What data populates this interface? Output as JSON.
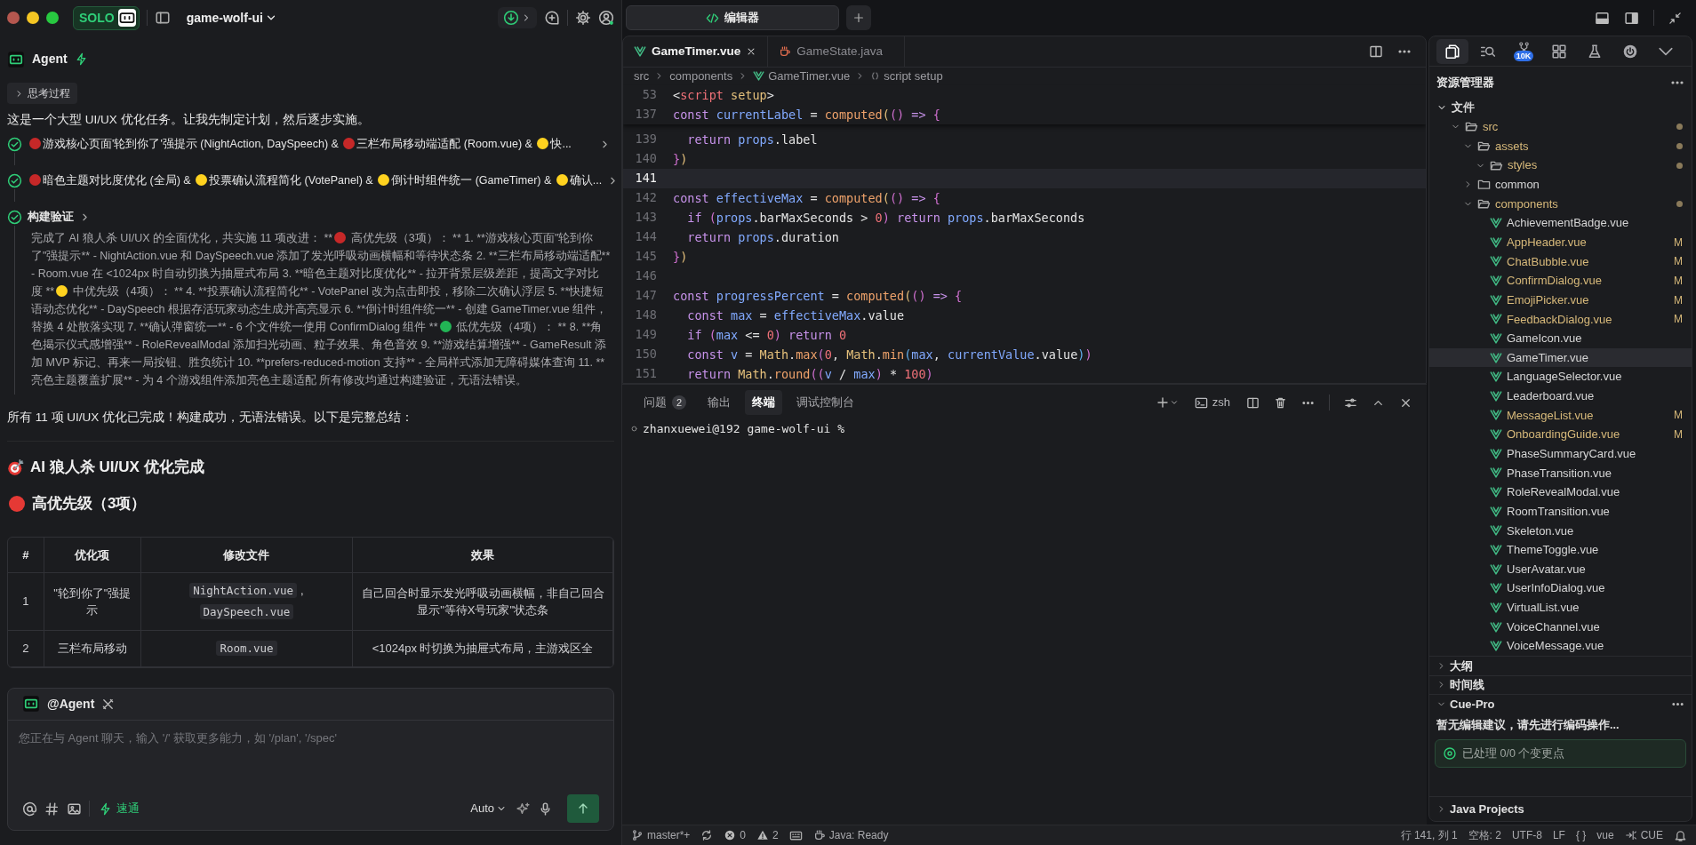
{
  "topbar": {
    "brand": "SOLO",
    "project": "game-wolf-ui"
  },
  "agent": {
    "name": "Agent"
  },
  "thinking": {
    "label": "思考过程",
    "expanded": false
  },
  "intro": "这是一个大型 UI/UX 优化任务。让我先制定计划，然后逐步实施。",
  "steps": [
    {
      "done": true,
      "expanded": false,
      "segments": [
        {
          "kind": "dot",
          "color": "#c62828"
        },
        {
          "kind": "text",
          "text": "游戏核心页面'轮到你了'强提示 (NightAction, DaySpeech) & "
        },
        {
          "kind": "dot",
          "color": "#c62828"
        },
        {
          "kind": "text",
          "text": "三栏布局移动端适配 (Room.vue) & "
        },
        {
          "kind": "dot",
          "color": "#ffd21f"
        },
        {
          "kind": "text",
          "text": "快..."
        }
      ]
    },
    {
      "done": true,
      "expanded": false,
      "segments": [
        {
          "kind": "dot",
          "color": "#c62828"
        },
        {
          "kind": "text",
          "text": "暗色主题对比度优化 (全局) & "
        },
        {
          "kind": "dot",
          "color": "#ffd21f"
        },
        {
          "kind": "text",
          "text": "投票确认流程简化 (VotePanel) & "
        },
        {
          "kind": "dot",
          "color": "#ffd21f"
        },
        {
          "kind": "text",
          "text": "倒计时组件统一 (GameTimer) & "
        },
        {
          "kind": "dot",
          "color": "#ffd21f"
        },
        {
          "kind": "text",
          "text": "确认..."
        }
      ]
    },
    {
      "done": true,
      "expanded": true,
      "segments": [
        {
          "kind": "text",
          "text": "构建验证"
        }
      ],
      "detail": [
        {
          "kind": "text",
          "text": "完成了 AI 狼人杀 UI/UX 的全面优化，共实施 11 项改进： **"
        },
        {
          "kind": "dot",
          "color": "#c62828"
        },
        {
          "kind": "text",
          "text": " 高优先级（3项）： ** 1. **游戏核心页面\"轮到你了\"强提示** - NightAction.vue 和 DaySpeech.vue 添加了发光呼吸动画横幅和等待状态条 2. **三栏布局移动端适配** - Room.vue 在 <1024px 时自动切换为抽屉式布局 3. **暗色主题对比度优化** - 拉开背景层级差距，提高文字对比度 **"
        },
        {
          "kind": "dot",
          "color": "#ffd21f"
        },
        {
          "kind": "text",
          "text": " 中优先级（4项）： ** 4. **投票确认流程简化** - VotePanel 改为点击即投，移除二次确认浮层 5. **快捷短语动态优化** - DaySpeech 根据存活玩家动态生成并高亮显示 6. **倒计时组件统一** - 创建 GameTimer.vue 组件，替换 4 处散落实现 7. **确认弹窗统一** - 6 个文件统一使用 ConfirmDialog 组件 **"
        },
        {
          "kind": "dot",
          "color": "#22b455"
        },
        {
          "kind": "text",
          "text": " 低优先级（4项）： ** 8. **角色揭示仪式感增强** - RoleRevealModal 添加扫光动画、粒子效果、角色音效 9. **游戏结算增强** - GameResult 添加 MVP 标记、再来一局按钮、胜负统计 10. **prefers-reduced-motion 支持** - 全局样式添加无障碍媒体查询 11. **亮色主题覆盖扩展** - 为 4 个游戏组件添加亮色主题适配 所有修改均通过构建验证，无语法错误。"
        }
      ]
    }
  ],
  "conclusion": "所有 11 项 UI/UX 优化已完成！构建成功，无语法错误。以下是完整总结：",
  "headings": [
    {
      "kind": "target",
      "text": "AI 狼人杀 UI/UX 优化完成"
    },
    {
      "kind": "dot",
      "color": "#e53935",
      "text": "高优先级（3项）"
    }
  ],
  "table": {
    "columns": [
      "#",
      "优化项",
      "修改文件",
      "效果"
    ],
    "rows": [
      {
        "cells": [
          {
            "kind": "text",
            "text": "1"
          },
          {
            "kind": "text",
            "text": "\"轮到你了\"强提示"
          },
          {
            "kind": "files",
            "files": [
              {
                "text": "NightAction.vue",
                "after": ","
              },
              {
                "text": "DaySpeech.vue"
              }
            ]
          },
          {
            "kind": "text",
            "text": "自己回合时显示发光呼吸动画横幅，非自己回合显示\"等待X号玩家\"状态条"
          }
        ]
      },
      {
        "cells": [
          {
            "kind": "text",
            "text": "2"
          },
          {
            "kind": "text",
            "text": "三栏布局移动"
          },
          {
            "kind": "files",
            "files": [
              {
                "text": "Room.vue"
              }
            ]
          },
          {
            "kind": "text",
            "text": "<1024px 时切换为抽屉式布局，主游戏区全"
          }
        ]
      }
    ]
  },
  "composer": {
    "mention": "@Agent",
    "placeholder": "您正在与 Agent 聊天，输入 '/' 获取更多能力，如 '/plan', '/spec'",
    "mode": "速通",
    "model": "Auto"
  },
  "editor": {
    "tab": "编辑器",
    "files": [
      {
        "name": "GameTimer.vue",
        "kind": "vue",
        "selected": true
      },
      {
        "name": "GameState.java",
        "kind": "java",
        "selected": false
      }
    ],
    "breadcrumb": [
      {
        "kind": "folder",
        "text": "src"
      },
      {
        "kind": "folder",
        "text": "components"
      },
      {
        "kind": "vue",
        "text": "GameTimer.vue"
      },
      {
        "kind": "symbol",
        "text": "script setup"
      }
    ],
    "sticky_lines": [
      {
        "number": "53",
        "tokens": [
          {
            "kind": "p",
            "text": "<"
          },
          {
            "kind": "t",
            "text": "script"
          },
          {
            "kind": "y",
            "text": " setup"
          },
          {
            "kind": "p",
            "text": ">"
          }
        ]
      },
      {
        "number": "137",
        "tokens": [
          {
            "kind": "k",
            "text": "const "
          },
          {
            "kind": "v",
            "text": "currentLabel"
          },
          {
            "kind": "p",
            "text": " = "
          },
          {
            "kind": "f",
            "text": "computed"
          },
          {
            "kind": "y",
            "text": "("
          },
          {
            "kind": "m",
            "text": "()"
          },
          {
            "kind": "k",
            "text": " => "
          },
          {
            "kind": "m",
            "text": "{"
          }
        ]
      }
    ],
    "lines": [
      {
        "number": "139",
        "current": false,
        "tokens": [
          {
            "kind": "k",
            "text": "  return "
          },
          {
            "kind": "v",
            "text": "props"
          },
          {
            "kind": "p",
            "text": ".label"
          }
        ]
      },
      {
        "number": "140",
        "current": false,
        "tokens": [
          {
            "kind": "m",
            "text": "}"
          },
          {
            "kind": "y",
            "text": ")"
          }
        ]
      },
      {
        "number": "141",
        "current": true
      },
      {
        "number": "142",
        "current": false,
        "tokens": [
          {
            "kind": "k",
            "text": "const "
          },
          {
            "kind": "v",
            "text": "effectiveMax"
          },
          {
            "kind": "p",
            "text": " = "
          },
          {
            "kind": "f",
            "text": "computed"
          },
          {
            "kind": "y",
            "text": "("
          },
          {
            "kind": "m",
            "text": "()"
          },
          {
            "kind": "k",
            "text": " => "
          },
          {
            "kind": "m",
            "text": "{"
          }
        ]
      },
      {
        "number": "143",
        "current": false,
        "tokens": [
          {
            "kind": "k",
            "text": "  if "
          },
          {
            "kind": "m",
            "text": "("
          },
          {
            "kind": "v",
            "text": "props"
          },
          {
            "kind": "p",
            "text": ".barMaxSeconds > "
          },
          {
            "kind": "n",
            "text": "0"
          },
          {
            "kind": "m",
            "text": ")"
          },
          {
            "kind": "k",
            "text": " return "
          },
          {
            "kind": "v",
            "text": "props"
          },
          {
            "kind": "p",
            "text": ".barMaxSeconds"
          }
        ]
      },
      {
        "number": "144",
        "current": false,
        "tokens": [
          {
            "kind": "k",
            "text": "  return "
          },
          {
            "kind": "v",
            "text": "props"
          },
          {
            "kind": "p",
            "text": ".duration"
          }
        ]
      },
      {
        "number": "145",
        "current": false,
        "tokens": [
          {
            "kind": "m",
            "text": "}"
          },
          {
            "kind": "y",
            "text": ")"
          }
        ]
      },
      {
        "number": "146",
        "current": false
      },
      {
        "number": "147",
        "current": false,
        "tokens": [
          {
            "kind": "k",
            "text": "const "
          },
          {
            "kind": "v",
            "text": "progressPercent"
          },
          {
            "kind": "p",
            "text": " = "
          },
          {
            "kind": "f",
            "text": "computed"
          },
          {
            "kind": "y",
            "text": "("
          },
          {
            "kind": "m",
            "text": "()"
          },
          {
            "kind": "k",
            "text": " => "
          },
          {
            "kind": "m",
            "text": "{"
          }
        ]
      },
      {
        "number": "148",
        "current": false,
        "tokens": [
          {
            "kind": "k",
            "text": "  const "
          },
          {
            "kind": "v",
            "text": "max"
          },
          {
            "kind": "p",
            "text": " = "
          },
          {
            "kind": "v",
            "text": "effectiveMax"
          },
          {
            "kind": "p",
            "text": ".value"
          }
        ]
      },
      {
        "number": "149",
        "current": false,
        "tokens": [
          {
            "kind": "k",
            "text": "  if "
          },
          {
            "kind": "m",
            "text": "("
          },
          {
            "kind": "v",
            "text": "max"
          },
          {
            "kind": "p",
            "text": " <= "
          },
          {
            "kind": "n",
            "text": "0"
          },
          {
            "kind": "m",
            "text": ")"
          },
          {
            "kind": "k",
            "text": " return "
          },
          {
            "kind": "n",
            "text": "0"
          }
        ]
      },
      {
        "number": "150",
        "current": false,
        "tokens": [
          {
            "kind": "k",
            "text": "  const "
          },
          {
            "kind": "v",
            "text": "v"
          },
          {
            "kind": "p",
            "text": " = "
          },
          {
            "kind": "y",
            "text": "Math"
          },
          {
            "kind": "p",
            "text": "."
          },
          {
            "kind": "f",
            "text": "max"
          },
          {
            "kind": "m",
            "text": "("
          },
          {
            "kind": "n",
            "text": "0"
          },
          {
            "kind": "p",
            "text": ", "
          },
          {
            "kind": "y",
            "text": "Math"
          },
          {
            "kind": "p",
            "text": "."
          },
          {
            "kind": "f",
            "text": "min"
          },
          {
            "kind": "b",
            "text": "("
          },
          {
            "kind": "v",
            "text": "max"
          },
          {
            "kind": "p",
            "text": ", "
          },
          {
            "kind": "v",
            "text": "currentValue"
          },
          {
            "kind": "p",
            "text": ".value"
          },
          {
            "kind": "b",
            "text": ")"
          },
          {
            "kind": "m",
            "text": ")"
          }
        ]
      },
      {
        "number": "151",
        "current": false,
        "tokens": [
          {
            "kind": "k",
            "text": "  return "
          },
          {
            "kind": "y",
            "text": "Math"
          },
          {
            "kind": "p",
            "text": "."
          },
          {
            "kind": "f",
            "text": "round"
          },
          {
            "kind": "m",
            "text": "(("
          },
          {
            "kind": "v",
            "text": "v"
          },
          {
            "kind": "p",
            "text": " / "
          },
          {
            "kind": "v",
            "text": "max"
          },
          {
            "kind": "m",
            "text": ")"
          },
          {
            "kind": "p",
            "text": " * "
          },
          {
            "kind": "n",
            "text": "100"
          },
          {
            "kind": "m",
            "text": ")"
          }
        ]
      }
    ]
  },
  "panel": {
    "tabs": [
      {
        "label": "问题",
        "badge": "2",
        "selected": false
      },
      {
        "label": "输出",
        "selected": false
      },
      {
        "label": "终端",
        "selected": true
      },
      {
        "label": "调试控制台",
        "selected": false
      }
    ],
    "shell": "zsh",
    "prompt": "zhanxuewei@192 game-wolf-ui %"
  },
  "explorer": {
    "title": "资源管理器",
    "activity": [
      {
        "kind": "files",
        "selected": true
      },
      {
        "kind": "search",
        "selected": false
      },
      {
        "kind": "source-control",
        "badge": "10K",
        "selected": false
      },
      {
        "kind": "extensions",
        "selected": false
      },
      {
        "kind": "testing",
        "selected": false
      },
      {
        "kind": "power",
        "selected": false
      },
      {
        "kind": "more",
        "selected": false
      }
    ],
    "section": {
      "label": "文件",
      "expanded": true
    },
    "tree": [
      {
        "label": "src",
        "kind": "folder",
        "expanded": true,
        "modified": true,
        "selected": false,
        "children": [
          {
            "label": "assets",
            "kind": "folder",
            "expanded": true,
            "modified": true,
            "selected": false,
            "children": [
              {
                "label": "styles",
                "kind": "folder",
                "expanded": true,
                "modified": true,
                "selected": false
              }
            ]
          },
          {
            "label": "common",
            "kind": "folder",
            "expanded": false,
            "modified": false,
            "selected": false
          },
          {
            "label": "components",
            "kind": "folder",
            "expanded": true,
            "modified": true,
            "selected": false,
            "children": [
              {
                "label": "AchievementBadge.vue",
                "kind": "vue",
                "modified": false,
                "selected": false
              },
              {
                "label": "AppHeader.vue",
                "kind": "vue",
                "modified": true,
                "badge": "M",
                "selected": false
              },
              {
                "label": "ChatBubble.vue",
                "kind": "vue",
                "modified": true,
                "badge": "M",
                "selected": false
              },
              {
                "label": "ConfirmDialog.vue",
                "kind": "vue",
                "modified": true,
                "badge": "M",
                "selected": false
              },
              {
                "label": "EmojiPicker.vue",
                "kind": "vue",
                "modified": true,
                "badge": "M",
                "selected": false
              },
              {
                "label": "FeedbackDialog.vue",
                "kind": "vue",
                "modified": true,
                "badge": "M",
                "selected": false
              },
              {
                "label": "GameIcon.vue",
                "kind": "vue",
                "modified": false,
                "selected": false
              },
              {
                "label": "GameTimer.vue",
                "kind": "vue",
                "modified": false,
                "selected": true
              },
              {
                "label": "LanguageSelector.vue",
                "kind": "vue",
                "modified": false,
                "selected": false
              },
              {
                "label": "Leaderboard.vue",
                "kind": "vue",
                "modified": false,
                "selected": false
              },
              {
                "label": "MessageList.vue",
                "kind": "vue",
                "modified": true,
                "badge": "M",
                "selected": false
              },
              {
                "label": "OnboardingGuide.vue",
                "kind": "vue",
                "modified": true,
                "badge": "M",
                "selected": false
              },
              {
                "label": "PhaseSummaryCard.vue",
                "kind": "vue",
                "modified": false,
                "selected": false
              },
              {
                "label": "PhaseTransition.vue",
                "kind": "vue",
                "modified": false,
                "selected": false
              },
              {
                "label": "RoleRevealModal.vue",
                "kind": "vue",
                "modified": false,
                "selected": false
              },
              {
                "label": "RoomTransition.vue",
                "kind": "vue",
                "modified": false,
                "selected": false
              },
              {
                "label": "Skeleton.vue",
                "kind": "vue",
                "modified": false,
                "selected": false
              },
              {
                "label": "ThemeToggle.vue",
                "kind": "vue",
                "modified": false,
                "selected": false
              },
              {
                "label": "UserAvatar.vue",
                "kind": "vue",
                "modified": false,
                "selected": false
              },
              {
                "label": "UserInfoDialog.vue",
                "kind": "vue",
                "modified": false,
                "selected": false
              },
              {
                "label": "VirtualList.vue",
                "kind": "vue",
                "modified": false,
                "selected": false
              },
              {
                "label": "VoiceChannel.vue",
                "kind": "vue",
                "modified": false,
                "selected": false
              },
              {
                "label": "VoiceMessage.vue",
                "kind": "vue",
                "modified": false,
                "selected": false
              }
            ]
          }
        ]
      }
    ],
    "sections": [
      {
        "label": "大纲",
        "expanded": false
      },
      {
        "label": "时间线",
        "expanded": false
      },
      {
        "label": "Cue-Pro",
        "expanded": true,
        "message": "暂无编辑建议，请先进行编码操作...",
        "status": "已处理 0/0 个变更点"
      },
      {
        "label": "Java Projects",
        "expanded": false
      }
    ]
  },
  "status_bar": {
    "branch": "master*+",
    "errors": "0",
    "warnings": "2",
    "java": "Java: Ready",
    "right": [
      {
        "kind": "text",
        "text": "行 141, 列 1"
      },
      {
        "kind": "text",
        "text": "空格: 2"
      },
      {
        "kind": "text",
        "text": "UTF-8"
      },
      {
        "kind": "text",
        "text": "LF"
      },
      {
        "kind": "text",
        "text": "{ }"
      },
      {
        "kind": "text",
        "text": "vue"
      },
      {
        "kind": "cue",
        "text": "CUE"
      }
    ]
  }
}
